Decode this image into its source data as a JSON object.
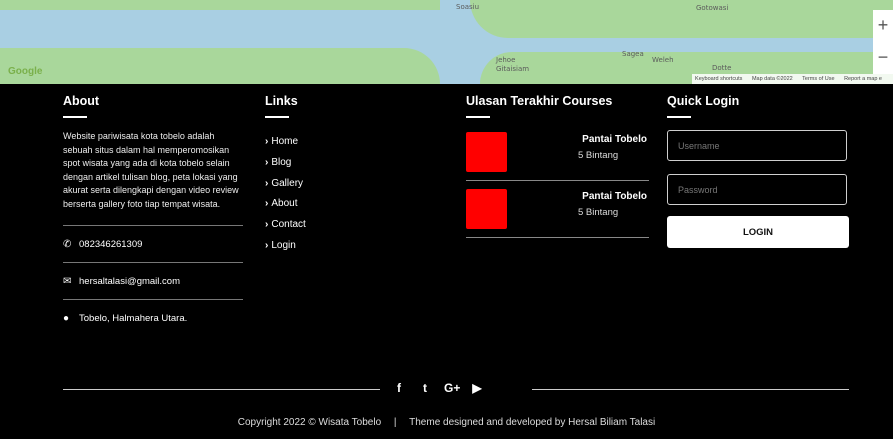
{
  "map": {
    "labels": [
      "Soasiu",
      "Gotowasi",
      "Sagea",
      "Weleh",
      "Jehoe",
      "Gitaisiam",
      "Dotte"
    ],
    "google_logo": "Google",
    "zoom_in": "+",
    "zoom_out": "−",
    "attribution": [
      "Keyboard shortcuts",
      "Map data ©2022",
      "Terms of Use",
      "Report a map e"
    ],
    "water_color": "#a9cfe3",
    "land_color": "#a9d79b"
  },
  "about": {
    "heading": "About",
    "description": "Website pariwisata kota tobelo adalah sebuah situs dalam hal memperomosikan spot wisata yang ada di kota tobelo selain dengan artikel tulisan blog, peta lokasi yang akurat serta dilengkapi dengan video review berserta gallery foto tiap tempat wisata.",
    "phone": "082346261309",
    "email": "hersaltalasi@gmail.com",
    "address": "Tobelo, Halmahera Utara.",
    "phone_icon": "phone-icon",
    "email_icon": "envelope-icon",
    "address_icon": "map-marker-icon"
  },
  "links": {
    "heading": "Links",
    "items": [
      "Home",
      "Blog",
      "Gallery",
      "About",
      "Contact",
      "Login"
    ]
  },
  "courses": {
    "heading": "Ulasan Terakhir Courses",
    "items": [
      {
        "title": "Pantai Tobelo",
        "rating": "5 Bintang"
      },
      {
        "title": "Pantai Tobelo",
        "rating": "5 Bintang"
      }
    ],
    "thumb_color": "#ff0000"
  },
  "login": {
    "heading": "Quick Login",
    "username_placeholder": "Username",
    "password_placeholder": "Password",
    "button_label": "LOGIN"
  },
  "social": {
    "icons": [
      "facebook-icon",
      "twitter-icon",
      "google-plus-icon",
      "youtube-icon"
    ],
    "glyphs": [
      "f",
      "t",
      "G+",
      "▶"
    ]
  },
  "footer": {
    "copyright": "Copyright 2022 © Wisata Tobelo",
    "separator": "|",
    "credit": "Theme designed and developed by Hersal Biliam Talasi"
  }
}
